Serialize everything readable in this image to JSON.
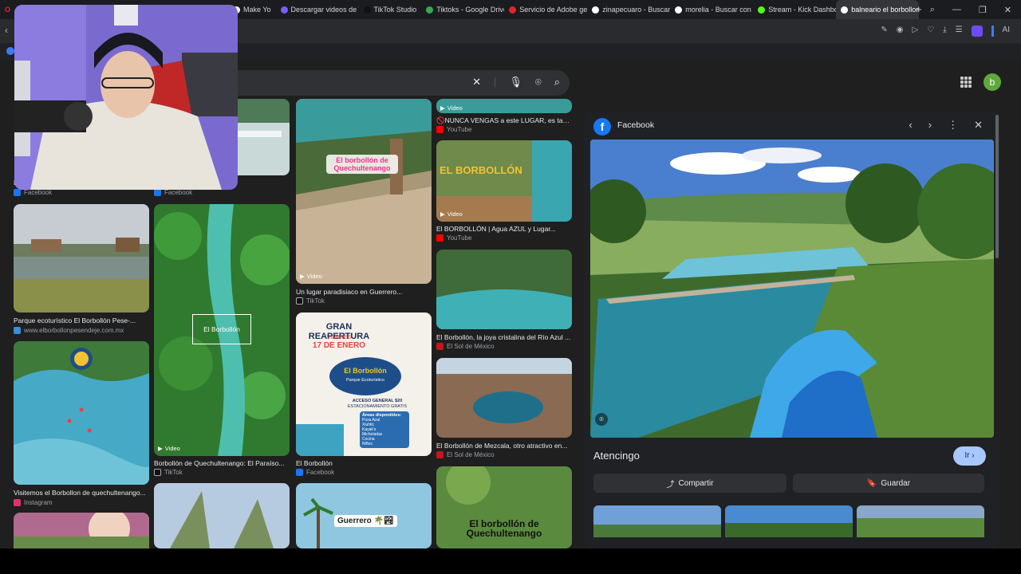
{
  "browser": {
    "tabs": [
      {
        "label": "Make Yo",
        "color": "#ffffff"
      },
      {
        "label": "Descargar videos de Ti",
        "color": "#7b5cf5"
      },
      {
        "label": "TikTok Studio",
        "color": "#111111"
      },
      {
        "label": "Tiktoks - Google Drive",
        "color": "#34a853"
      },
      {
        "label": "Servicio de Adobe gen",
        "color": "#e0242b"
      },
      {
        "label": "zinapecuaro - Buscar c",
        "color": "#ffffff"
      },
      {
        "label": "morelia - Buscar con G",
        "color": "#ffffff"
      },
      {
        "label": "Stream - Kick Dashboa",
        "color": "#53fc18"
      },
      {
        "label": "balneario el borbollon - B",
        "color": "#ffffff"
      }
    ],
    "new_tab": "+",
    "toolbar_ai": "AI"
  },
  "account": {
    "initial": "b",
    "color": "#5fa83d"
  },
  "results": {
    "col1": [
      {
        "caption": "B",
        "source": "Facebook",
        "source_color": "#1877f2"
      },
      {
        "caption": "Parque ecoturístico El Borbollón Pese-...",
        "source": "www.elborbollonpesendeje.com.mx",
        "source_color": "#3c8cd6"
      },
      {
        "caption": "Visitemos el Borbollon de quechultenango...",
        "source": "Instagram",
        "source_color": "#e1306c"
      }
    ],
    "col2": [
      {
        "caption": "",
        "source": "Facebook",
        "source_color": "#1877f2"
      },
      {
        "caption": "Borbollón de Quechultenango: El Paraíso...",
        "source": "TikTok",
        "source_color": "#111111",
        "badge": "Video",
        "overlay": "El Borbollón"
      }
    ],
    "col3": [
      {
        "caption": "Un lugar paradisiaco en Guerrero...",
        "source": "TikTok",
        "source_color": "#111111",
        "badge": "Video",
        "overlay": "El borbollón de Quechultenango"
      },
      {
        "caption": "El Borbollón",
        "source": "Facebook",
        "source_color": "#1877f2",
        "poster": {
          "headline": "GRAN REAPERTURA",
          "day": "VIERNES",
          "date": "17 DE ENERO",
          "logo": "El Borbollón",
          "logo_sub": "Parque Ecoturístico",
          "price": "ACCESO GENERAL $20",
          "parking": "ESTACIONAMIENTO GRATIS",
          "areas_title": "Áreas disponibles:",
          "areas": [
            "Poza Azul",
            "Xiuhtic",
            "Kayak's",
            "Micheladas",
            "Cocina",
            "Niños"
          ]
        }
      },
      {
        "overlay": "Guerrero 🌴🏞"
      }
    ],
    "col4": [
      {
        "caption": "🚫NUNCA VENGAS a este LUGAR, es tan...",
        "source": "YouTube",
        "source_color": "#ff0000",
        "badge": "Video"
      },
      {
        "caption": "El BORBOLLÓN | Agua AZUL y Lugar...",
        "source": "YouTube",
        "source_color": "#ff0000",
        "badge": "Video",
        "overlay": "EL BORBOLLÓN"
      },
      {
        "caption": "El Borbollón, la joya cristalina del Río Azul ...",
        "source": "El Sol de México",
        "source_color": "#c4161c"
      },
      {
        "caption": "El Borbollón de Mezcala, otro atractivo en...",
        "source": "El Sol de México",
        "source_color": "#c4161c"
      },
      {
        "overlay": "El borbollón de Quechultenango"
      }
    ]
  },
  "panel": {
    "source": "Facebook",
    "title": "Atencingo",
    "visit": "Ir ›",
    "share": "Compartir",
    "save": "Guardar"
  }
}
